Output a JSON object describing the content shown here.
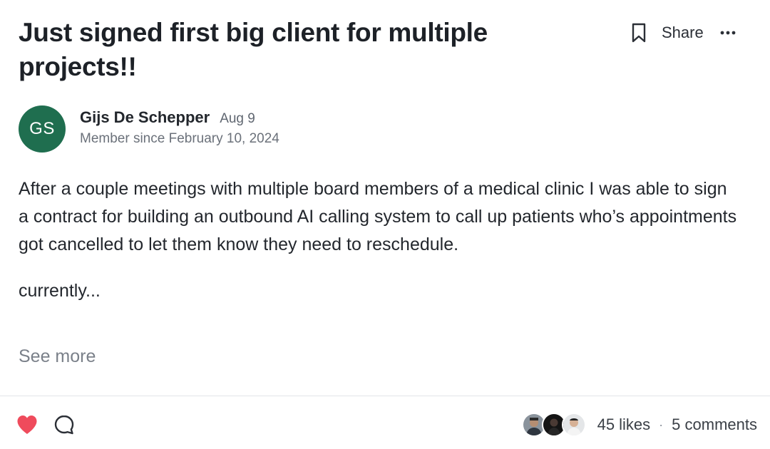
{
  "post": {
    "title": "Just signed first big client for multiple projects!!",
    "share_label": "Share",
    "icons": {
      "bookmark": "bookmark-icon",
      "more": "more-horizontal-icon",
      "like": "heart-icon",
      "comment": "comment-bubble-icon"
    },
    "author": {
      "initials": "GS",
      "name": "Gijs De Schepper",
      "date": "Aug 9",
      "member_since": "Member since February 10, 2024",
      "avatar_color": "#1f6e4f"
    },
    "body": {
      "paragraph_1": "After a couple meetings with multiple board members of a medical clinic I was able to sign a contract for building an outbound AI calling system to call up patients who’s appointments got cancelled to let them know they need to reschedule.",
      "paragraph_2": "currently..."
    },
    "see_more_label": "See more",
    "footer": {
      "likes": "45 likes",
      "separator": "·",
      "comments": "5 comments",
      "like_color": "#ef4b5c"
    }
  }
}
